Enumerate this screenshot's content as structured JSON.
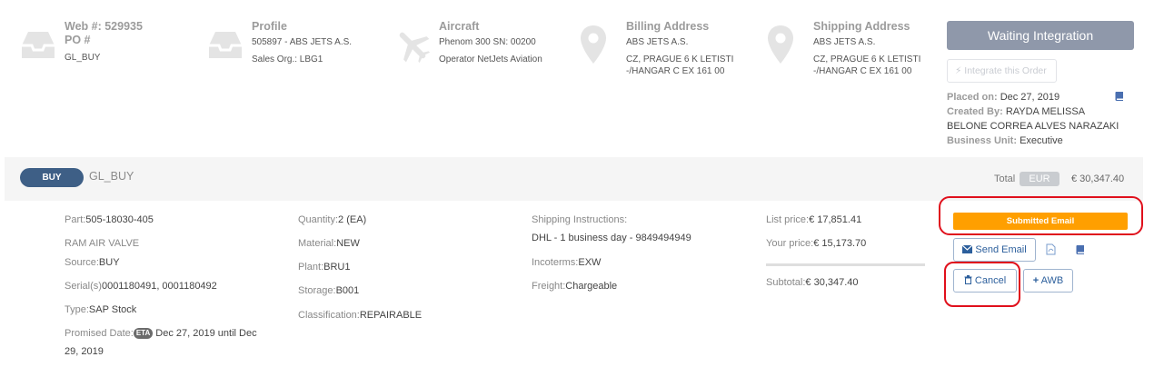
{
  "header": {
    "web": {
      "line1": "Web #: 529935",
      "line2": "PO #",
      "line3": "GL_BUY",
      "icon": "inbox-icon"
    },
    "profile": {
      "title": "Profile",
      "line1": "505897 - ABS JETS A.S.",
      "line2": "Sales Org.: LBG1",
      "icon": "inbox-icon"
    },
    "aircraft": {
      "title": "Aircraft",
      "line1": "Phenom 300 SN: 00200",
      "line2": "Operator NetJets Aviation",
      "icon": "airplane-icon"
    },
    "billing": {
      "title": "Billing Address",
      "line1": "ABS JETS A.S.",
      "line2": "CZ, PRAGUE 6 K LETISTI",
      "line3": "-/HANGAR C EX 161 00",
      "icon": "map-pin-icon"
    },
    "shipping": {
      "title": "Shipping Address",
      "line1": "ABS JETS A.S.",
      "line2": "CZ, PRAGUE 6 K LETISTI",
      "line3": "-/HANGAR C EX 161 00",
      "icon": "map-pin-icon"
    }
  },
  "status": {
    "waiting_label": "Waiting Integration",
    "integrate_label": "Integrate this Order",
    "placed_label": "Placed on:",
    "placed_value": "Dec 27, 2019",
    "created_label": "Created By:",
    "created_value_1": "RAYDA MELISSA",
    "created_value_2": "BELONE CORREA ALVES NARAZAKI",
    "bu_label": "Business Unit:",
    "bu_value": "Executive"
  },
  "band": {
    "pill": "BUY",
    "text": "GL_BUY",
    "total_label": "Total",
    "currency": "EUR",
    "total_value": "€ 30,347.40"
  },
  "item": {
    "part_label": "Part:",
    "part_value": "505-18030-405",
    "description": "RAM AIR VALVE",
    "source_label": "Source:",
    "source_value": "BUY",
    "serial_label": "Serial(s)",
    "serial_value": "0001180491, 0001180492",
    "type_label": "Type:",
    "type_value": "SAP Stock",
    "promised_label": "Promised Date:",
    "eta_badge": "ETA",
    "promised_value_1": "Dec 27, 2019 until Dec",
    "promised_value_2": "29, 2019",
    "quantity_label": "Quantity:",
    "quantity_value": "2 (EA)",
    "material_label": "Material:",
    "material_value": "NEW",
    "plant_label": "Plant:",
    "plant_value": "BRU1",
    "storage_label": "Storage:",
    "storage_value": "B001",
    "classification_label": "Classification:",
    "classification_value": "REPAIRABLE",
    "shipping_label": "Shipping Instructions:",
    "shipping_value": "DHL - 1 business day - 9849494949",
    "incoterms_label": "Incoterms:",
    "incoterms_value": "EXW",
    "freight_label": "Freight:",
    "freight_value": "Chargeable",
    "list_label": "List price:",
    "list_value": "€ 17,851.41",
    "your_label": "Your price:",
    "your_value": "€ 15,173.70",
    "subtotal_label": "Subtotal:",
    "subtotal_value": "€ 30,347.40"
  },
  "actions": {
    "submitted_label": "Submitted Email",
    "send_email_label": "Send Email",
    "cancel_label": "Cancel",
    "awb_label": "AWB"
  },
  "colors": {
    "accent_blue": "#3e5f86",
    "waiting_gray": "#8f98aa",
    "submitted_orange": "#ff9f00",
    "annotation_red": "#e0101c"
  }
}
